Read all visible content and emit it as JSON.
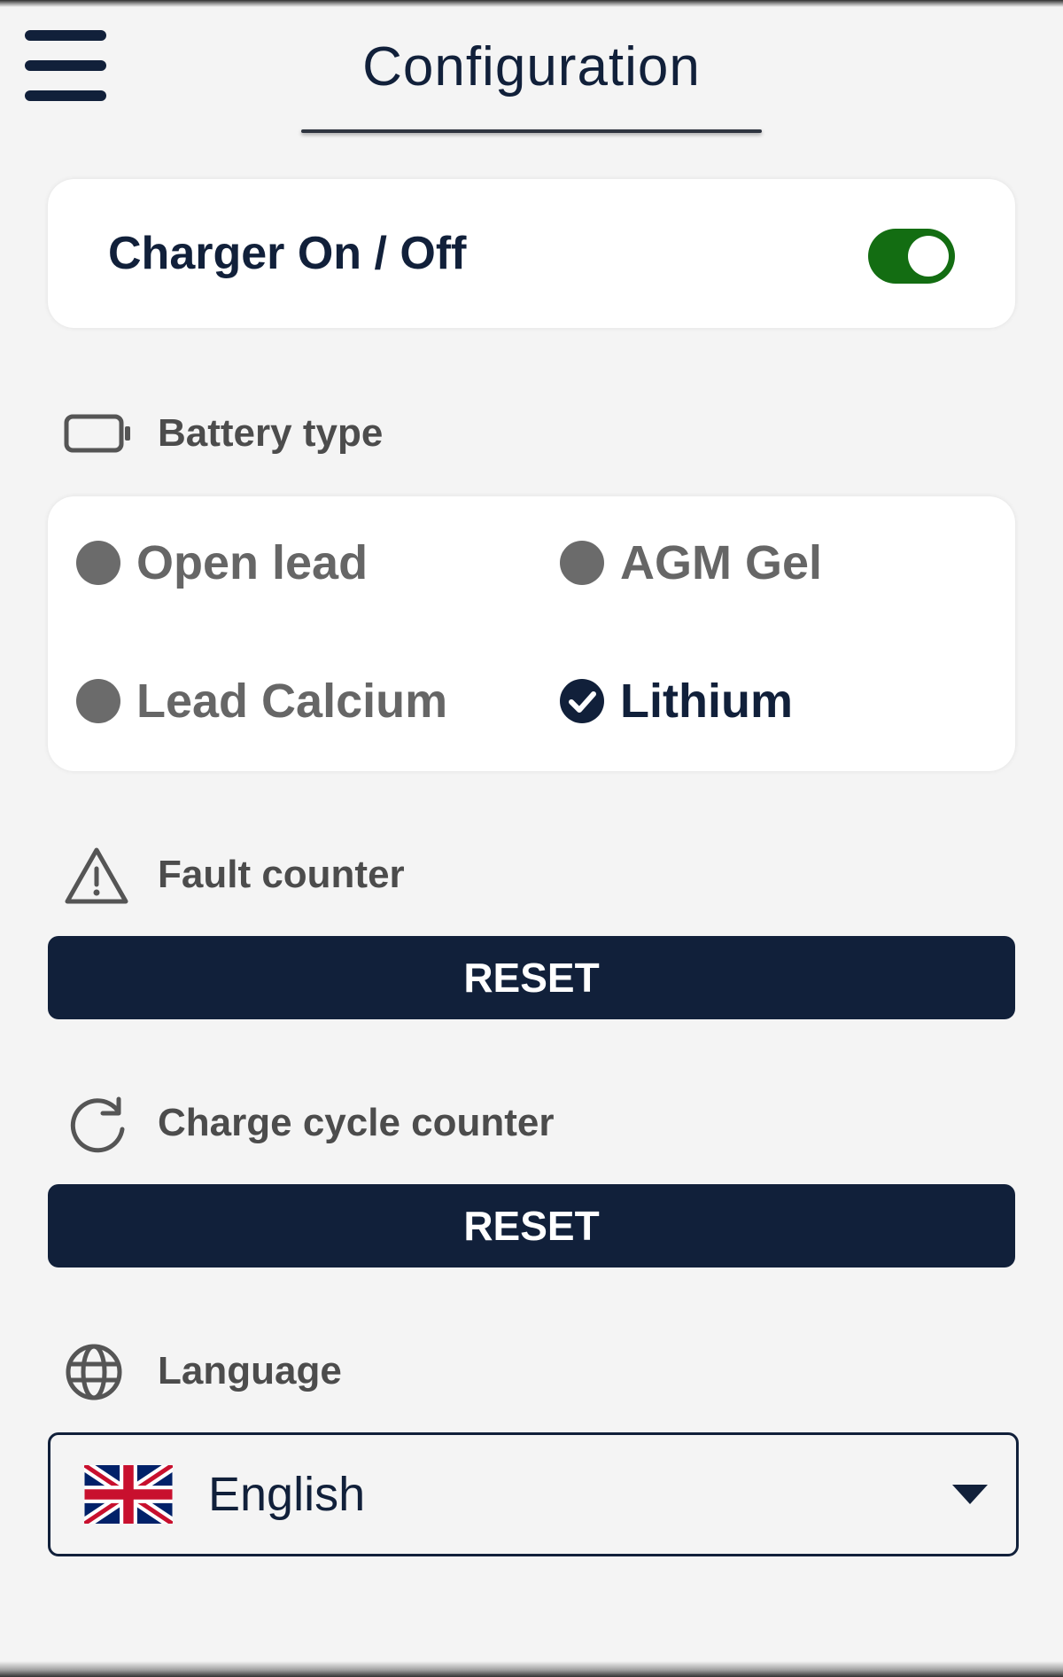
{
  "header": {
    "title": "Configuration",
    "menu_icon": "hamburger-menu-icon"
  },
  "charger": {
    "label": "Charger On / Off",
    "enabled": true,
    "toggle_color": "#136d12"
  },
  "battery_type": {
    "label": "Battery type",
    "icon": "battery-icon",
    "options": [
      {
        "label": "Open lead",
        "selected": false
      },
      {
        "label": "AGM Gel",
        "selected": false
      },
      {
        "label": "Lead Calcium",
        "selected": false
      },
      {
        "label": "Lithium",
        "selected": true
      }
    ]
  },
  "fault_counter": {
    "label": "Fault counter",
    "icon": "warning-icon",
    "button_label": "RESET"
  },
  "charge_cycle_counter": {
    "label": "Charge cycle counter",
    "icon": "refresh-icon",
    "button_label": "RESET"
  },
  "language": {
    "label": "Language",
    "icon": "globe-icon",
    "selected_value": "English",
    "flag_icon": "uk-flag-icon"
  },
  "colors": {
    "primary": "#11203a",
    "background": "#f4f4f4",
    "card": "#ffffff",
    "inactive_option": "#6b6b6b"
  }
}
